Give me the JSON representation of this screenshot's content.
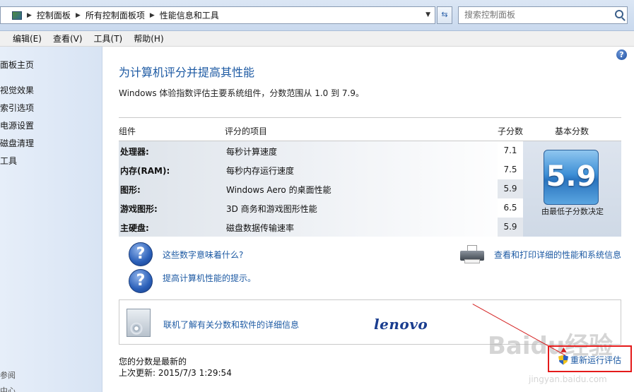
{
  "address_bar": {
    "breadcrumbs": [
      "控制面板",
      "所有控制面板项",
      "性能信息和工具"
    ],
    "search_placeholder": "搜索控制面板"
  },
  "menu": [
    "编辑(E)",
    "查看(V)",
    "工具(T)",
    "帮助(H)"
  ],
  "sidebar": {
    "items": [
      "面板主页",
      "视觉效果",
      "索引选项",
      "电源设置",
      "磁盘清理",
      "工具"
    ],
    "footer": [
      "参阅",
      "中心"
    ]
  },
  "main": {
    "title": "为计算机评分并提高其性能",
    "description": "Windows 体验指数评估主要系统组件，分数范围从 1.0 到 7.9。",
    "table": {
      "headers": [
        "组件",
        "评分的项目",
        "子分数",
        "基本分数"
      ],
      "rows": [
        {
          "component": "处理器:",
          "item": "每秒计算速度",
          "subscore": "7.1"
        },
        {
          "component": "内存(RAM):",
          "item": "每秒内存运行速度",
          "subscore": "7.5"
        },
        {
          "component": "图形:",
          "item": "Windows Aero 的桌面性能",
          "subscore": "5.9"
        },
        {
          "component": "游戏图形:",
          "item": "3D 商务和游戏图形性能",
          "subscore": "6.5"
        },
        {
          "component": "主硬盘:",
          "item": "磁盘数据传输速率",
          "subscore": "5.9"
        }
      ],
      "base_score": "5.9",
      "base_caption": "由最低子分数决定"
    },
    "links": {
      "what_numbers_mean": "这些数字意味着什么?",
      "tips": "提高计算机性能的提示。",
      "print_details": "查看和打印详细的性能和系统信息",
      "online_info": "联机了解有关分数和软件的详细信息"
    },
    "brand": "lenovo",
    "status": {
      "current": "您的分数是最新的",
      "last_update": "上次更新: 2015/7/3 1:29:54"
    },
    "rerun_label": "重新运行评估"
  },
  "watermark": {
    "brand": "Baidu经验",
    "url": "jingyan.baidu.com"
  }
}
